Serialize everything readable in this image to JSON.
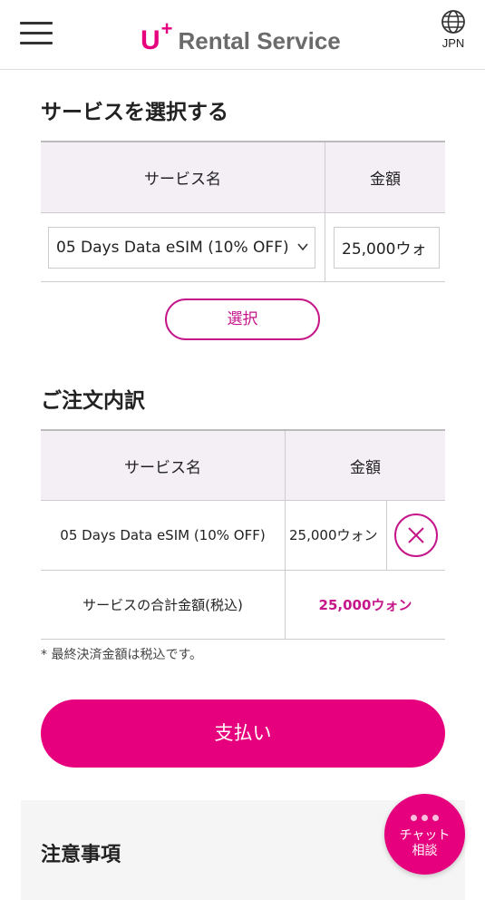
{
  "header": {
    "logo_mark": "U",
    "logo_plus": "+",
    "logo_text": "Rental Service",
    "lang_label": "JPN"
  },
  "select_section": {
    "title": "サービスを選択する",
    "col_service": "サービス名",
    "col_price": "金額",
    "selected_service": "05 Days Data eSIM (10% OFF)",
    "price_value": "25,000ウォ",
    "choose_button": "選択"
  },
  "order_section": {
    "title": "ご注文内訳",
    "col_service": "サービス名",
    "col_price": "金額",
    "items": [
      {
        "name": "05 Days Data eSIM (10% OFF)",
        "price": "25,000ウォン"
      }
    ],
    "total_label": "サービスの合計金額(税込)",
    "total_value": "25,000ウォン"
  },
  "note": "* 最終決済金額は税込です。",
  "pay_button": "支払い",
  "caution_title": "注意事項",
  "chat_button": "チャット\n相談",
  "colors": {
    "accent": "#e6007e",
    "accent_border": "#c5168a",
    "header_bg": "#f3eff5"
  },
  "icons": [
    "menu-icon",
    "globe-icon",
    "chevron-down-icon",
    "close-icon",
    "chat-dots-icon"
  ]
}
